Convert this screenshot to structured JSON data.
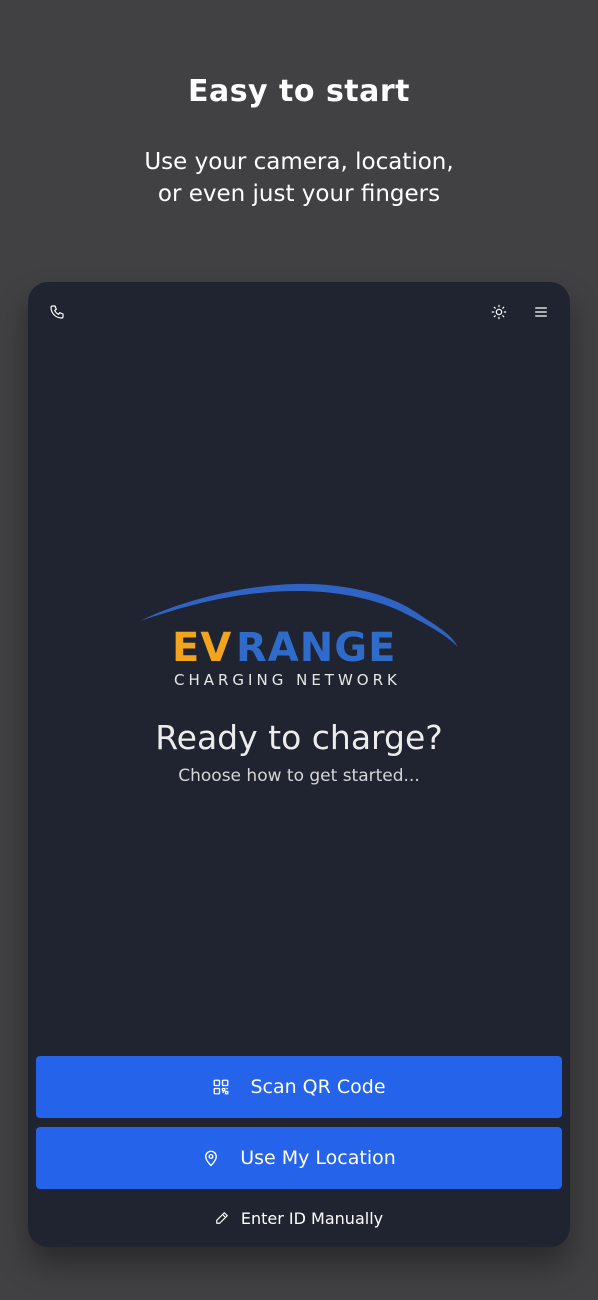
{
  "promo": {
    "title": "Easy to start",
    "subtitle_line1": "Use your camera, location,",
    "subtitle_line2": "or even just your fingers"
  },
  "topbar": {
    "left_icon": "phone-icon",
    "right_icons": [
      "sun-icon",
      "menu-icon"
    ]
  },
  "logo": {
    "ev": "EV",
    "range": "RANGE",
    "tagline": "CHARGING NETWORK"
  },
  "hero": {
    "title": "Ready to charge?",
    "subtitle": "Choose how to get started..."
  },
  "actions": {
    "scan_label": "Scan QR Code",
    "scan_icon": "qr-code-icon",
    "location_label": "Use My Location",
    "location_icon": "map-pin-icon",
    "manual_label": "Enter ID Manually",
    "manual_icon": "pencil-icon"
  },
  "colors": {
    "background": "#414143",
    "phone_bg": "#1f2430",
    "button_blue": "#2563eb",
    "logo_orange": "#f2a41c",
    "logo_blue": "#2f6bc9"
  }
}
